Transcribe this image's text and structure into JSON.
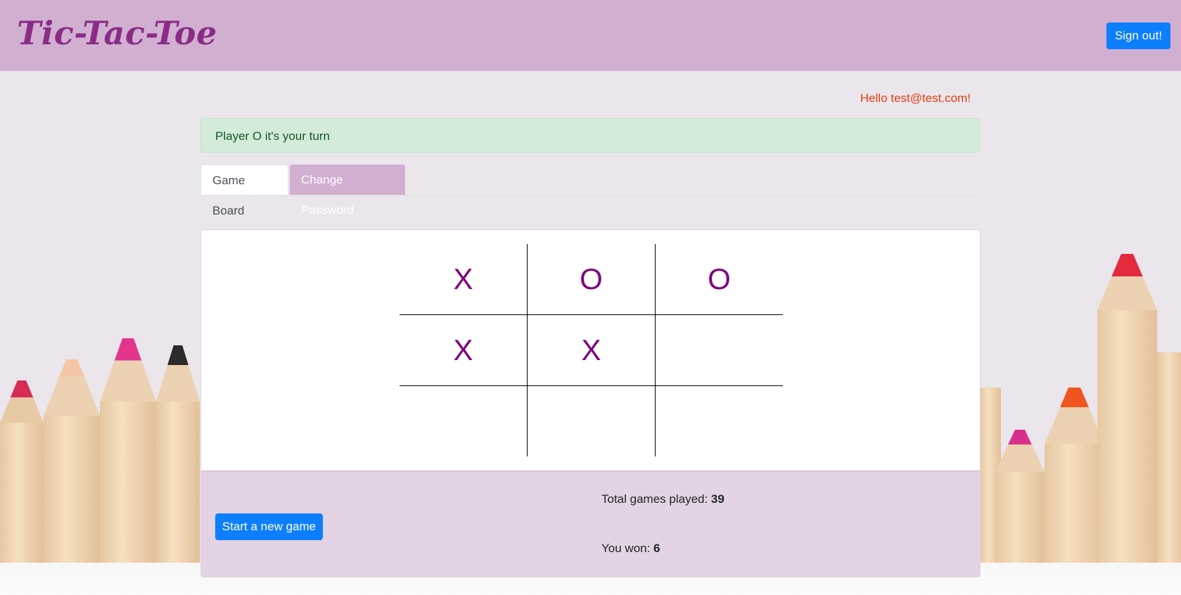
{
  "header": {
    "logo": "Tic-Tac-Toe",
    "signout_label": "Sign out!"
  },
  "greeting": "Hello test@test.com!",
  "alert": "Player O it's your turn",
  "tabs": [
    {
      "label": "Game Board",
      "active": true
    },
    {
      "label": "Change Password",
      "active": false
    }
  ],
  "board": {
    "cells": [
      "X",
      "O",
      "O",
      "X",
      "X",
      "",
      "",
      "",
      ""
    ]
  },
  "footer": {
    "new_game_label": "Start a new game",
    "total_label": "Total games played: ",
    "total_value": "39",
    "won_label": "You won: ",
    "won_value": "6"
  },
  "colors": {
    "header": "#d1afd1",
    "accent": "#0d7ffd",
    "mark": "#800080",
    "greeting": "#e33d0e"
  }
}
